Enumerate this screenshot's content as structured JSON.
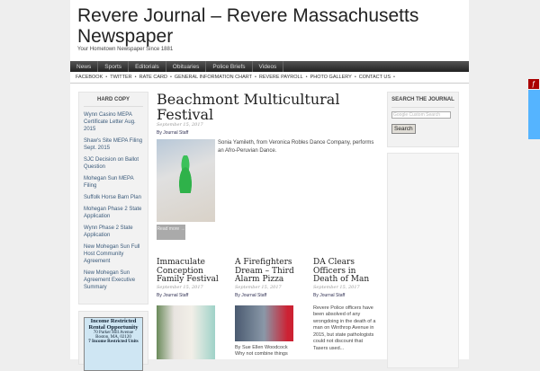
{
  "site": {
    "title": "Revere Journal – Revere Massachusetts Newspaper",
    "tagline": "Your Hometown Newspaper Since 1881"
  },
  "nav": [
    "News",
    "Sports",
    "Editorials",
    "Obituaries",
    "Police Briefs",
    "Videos"
  ],
  "links": [
    "FACEBOOK",
    "TWITTER",
    "RATE CARD",
    "GENERAL INFORMATION CHART",
    "REVERE PAYROLL",
    "PHOTO GALLERY",
    "CONTACT US"
  ],
  "sidebar": {
    "heading": "HARD COPY",
    "items": [
      "Wynn Casino MEPA Certificate Letter Aug. 2015",
      "Shaw's Site MEPA Filing Sept. 2015",
      "SJC Decision on Ballot Question",
      "Mohegan Sun MEPA Filing",
      "Suffolk Horse Barn Plan",
      "Mohegan Phase 2 State Application",
      "Wynn Phase 2 State Application",
      "New Mohegan Sun Full Host Community Agreement",
      "New Mohegan Sun Agreement Executive Summary"
    ]
  },
  "ad": {
    "line1": "Income Restricted",
    "line2": "Rental Opportunity",
    "line3": "70 Parker Hill Avenue",
    "line4": "Boston, MA, 02120",
    "line5": "7 Income Restricted Units"
  },
  "featured": {
    "title": "Beachmont Multicultural Festival",
    "date": "September 15, 2017",
    "by": "By Journal Staff",
    "caption": "Sonia Yamileth, from Veronica Robles Dance Company, performs an Afro-Peruvian Dance.",
    "read_more": "Read more →"
  },
  "articles": [
    {
      "title": "Immaculate Conception Family Festival",
      "date": "September 15, 2017",
      "by": "By Journal Staff",
      "text": ""
    },
    {
      "title": "A Firefighters Dream – Third Alarm Pizza",
      "date": "September 15, 2017",
      "by": "By Journal Staff",
      "text": "By Sue Ellen Woodcock Why not combine things"
    },
    {
      "title": "DA Clears Officers in Death of Man",
      "date": "September 15, 2017",
      "by": "By Journal Staff",
      "text": "Revere Police officers have been absolved of any wrongdoing in the death of a man on Winthrop Avenue in 2015, but state pathologists could not discount that Tasers used..."
    }
  ],
  "search": {
    "heading": "SEARCH THE JOURNAL",
    "placeholder": "Google Custom Search",
    "button": "Search"
  }
}
